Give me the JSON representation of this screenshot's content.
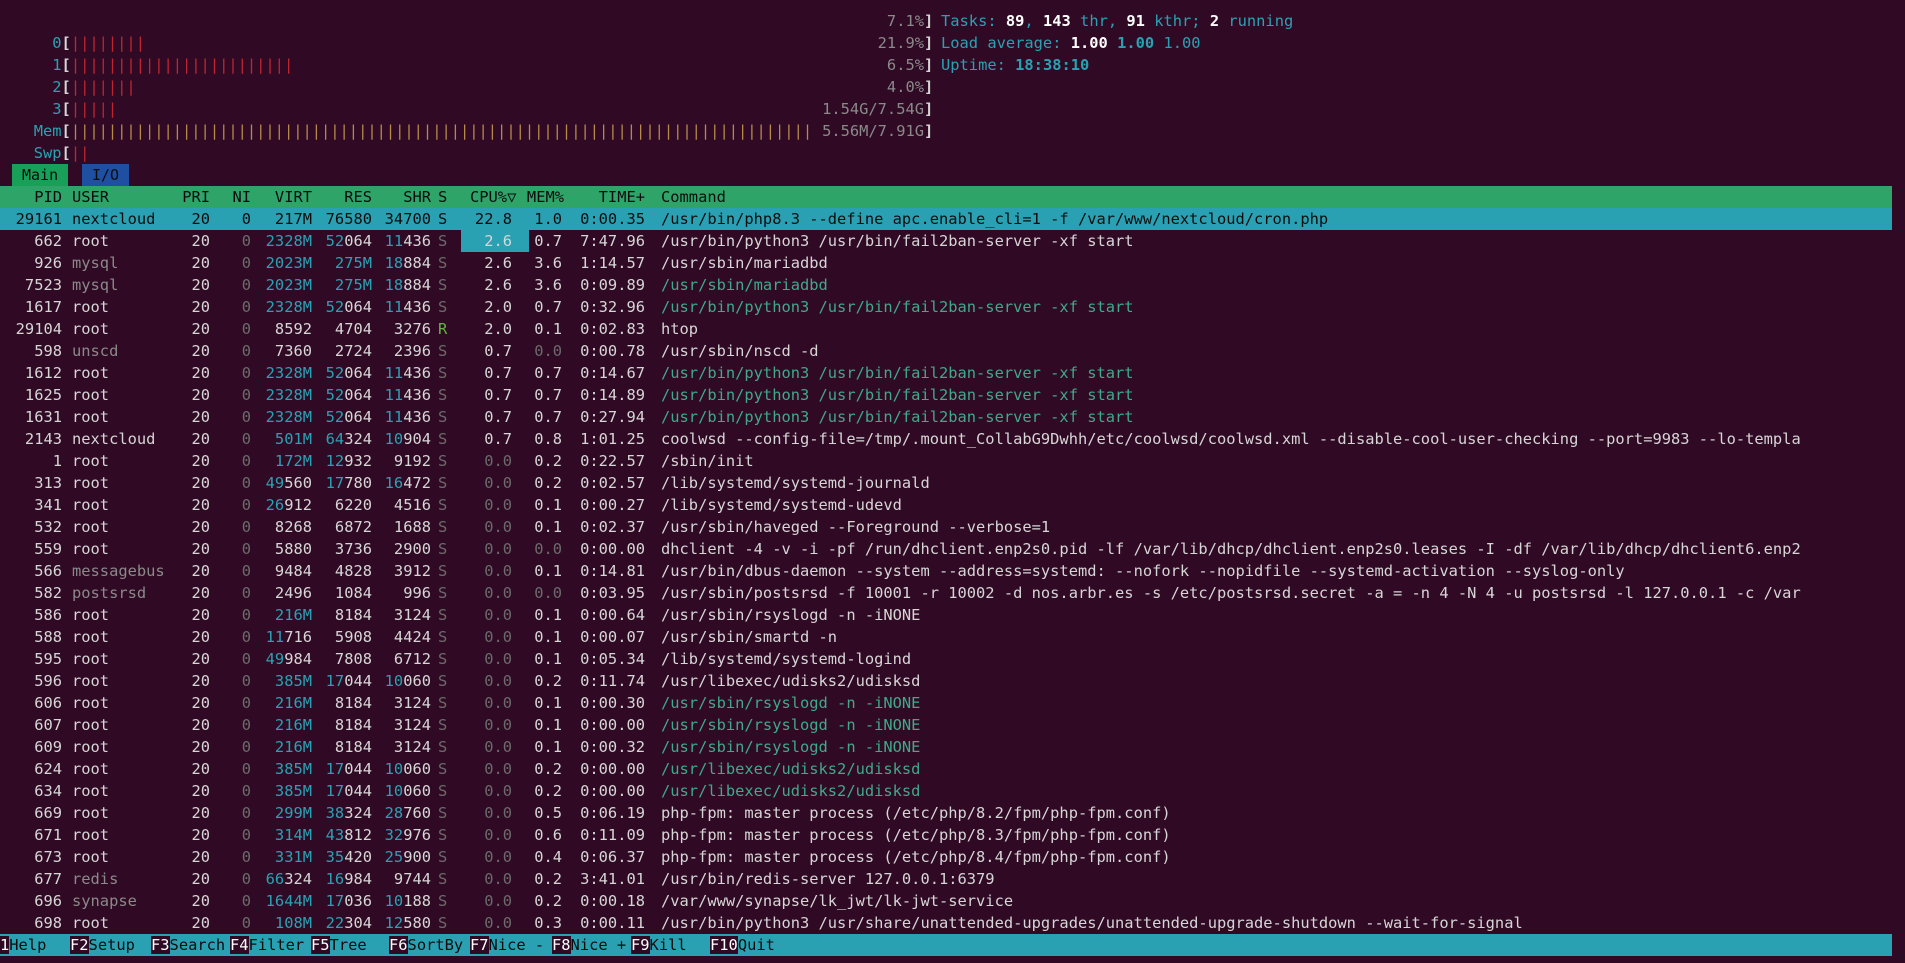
{
  "meters": {
    "cpu0": {
      "label": "0",
      "bars": "||||||||",
      "value": "7.1%"
    },
    "cpu1": {
      "label": "1",
      "bars": "||||||||||||||||||||||||",
      "value": "21.9%"
    },
    "cpu2": {
      "label": "2",
      "bars": "|||||||",
      "value": "6.5%"
    },
    "cpu3": {
      "label": "3",
      "bars": "|||||",
      "value": "4.0%"
    },
    "mem": {
      "label": "Mem",
      "bars": "||||||||||||||||||||||||||||||||||||||||||||||||||||||||||||||||||||||||||||||||",
      "value": "1.54G/7.54G"
    },
    "swp": {
      "label": "Swp",
      "bars": "||",
      "value": "5.56M/7.91G"
    }
  },
  "summary": {
    "tasks_label": "Tasks: ",
    "tasks": "89",
    "thr": "143",
    "kthr": "91",
    "running": "2",
    "thr_label": " thr, ",
    "kthr_label": " kthr; ",
    "running_label": " running",
    "load_label": "Load average: ",
    "load1": "1.00",
    "load5": "1.00",
    "load15": "1.00",
    "uptime_label": "Uptime: ",
    "uptime": "18:38:10"
  },
  "tabs": {
    "main": "Main",
    "io": "I/O"
  },
  "columns": {
    "pid": "PID",
    "user": "USER",
    "pri": "PRI",
    "ni": "NI",
    "virt": "VIRT",
    "res": "RES",
    "shr": "SHR",
    "s": "S",
    "cpu": "CPU%▽",
    "mem": "MEM%",
    "time": "TIME+",
    "cmd": "Command"
  },
  "processes": [
    {
      "pid": "29161",
      "user": "nextcloud",
      "pri": "20",
      "ni": "0",
      "virt": "217M",
      "res": "76580",
      "shr": "34700",
      "s": "S",
      "cpu": "22.8",
      "mem": "1.0",
      "time": "0:00.35",
      "cmd": "/usr/bin/php8.3 --define apc.enable_cli=1 -f /var/www/nextcloud/cron.php"
    },
    {
      "pid": "662",
      "user": "root",
      "pri": "20",
      "ni": "0",
      "virt": "2328M",
      "res": "52064",
      "shr": "11436",
      "s": "S",
      "cpu": "2.6",
      "mem": "0.7",
      "time": "7:47.96",
      "cmd": "/usr/bin/python3 /usr/bin/fail2ban-server -xf start"
    },
    {
      "pid": "926",
      "user": "mysql",
      "pri": "20",
      "ni": "0",
      "virt": "2023M",
      "res": "275M",
      "shr": "18884",
      "s": "S",
      "cpu": "2.6",
      "mem": "3.6",
      "time": "1:14.57",
      "cmd": "/usr/sbin/mariadbd"
    },
    {
      "pid": "7523",
      "user": "mysql",
      "pri": "20",
      "ni": "0",
      "virt": "2023M",
      "res": "275M",
      "shr": "18884",
      "s": "S",
      "cpu": "2.6",
      "mem": "3.6",
      "time": "0:09.89",
      "cmd": "/usr/sbin/mariadbd"
    },
    {
      "pid": "1617",
      "user": "root",
      "pri": "20",
      "ni": "0",
      "virt": "2328M",
      "res": "52064",
      "shr": "11436",
      "s": "S",
      "cpu": "2.0",
      "mem": "0.7",
      "time": "0:32.96",
      "cmd": "/usr/bin/python3 /usr/bin/fail2ban-server -xf start"
    },
    {
      "pid": "29104",
      "user": "root",
      "pri": "20",
      "ni": "0",
      "virt": "8592",
      "res": "4704",
      "shr": "3276",
      "s": "R",
      "cpu": "2.0",
      "mem": "0.1",
      "time": "0:02.83",
      "cmd": "htop"
    },
    {
      "pid": "598",
      "user": "unscd",
      "pri": "20",
      "ni": "0",
      "virt": "7360",
      "res": "2724",
      "shr": "2396",
      "s": "S",
      "cpu": "0.7",
      "mem": "0.0",
      "time": "0:00.78",
      "cmd": "/usr/sbin/nscd -d"
    },
    {
      "pid": "1612",
      "user": "root",
      "pri": "20",
      "ni": "0",
      "virt": "2328M",
      "res": "52064",
      "shr": "11436",
      "s": "S",
      "cpu": "0.7",
      "mem": "0.7",
      "time": "0:14.67",
      "cmd": "/usr/bin/python3 /usr/bin/fail2ban-server -xf start"
    },
    {
      "pid": "1625",
      "user": "root",
      "pri": "20",
      "ni": "0",
      "virt": "2328M",
      "res": "52064",
      "shr": "11436",
      "s": "S",
      "cpu": "0.7",
      "mem": "0.7",
      "time": "0:14.89",
      "cmd": "/usr/bin/python3 /usr/bin/fail2ban-server -xf start"
    },
    {
      "pid": "1631",
      "user": "root",
      "pri": "20",
      "ni": "0",
      "virt": "2328M",
      "res": "52064",
      "shr": "11436",
      "s": "S",
      "cpu": "0.7",
      "mem": "0.7",
      "time": "0:27.94",
      "cmd": "/usr/bin/python3 /usr/bin/fail2ban-server -xf start"
    },
    {
      "pid": "2143",
      "user": "nextcloud",
      "pri": "20",
      "ni": "0",
      "virt": "501M",
      "res": "64324",
      "shr": "10904",
      "s": "S",
      "cpu": "0.7",
      "mem": "0.8",
      "time": "1:01.25",
      "cmd": "coolwsd --config-file=/tmp/.mount_CollabG9Dwhh/etc/coolwsd/coolwsd.xml --disable-cool-user-checking --port=9983 --lo-templa"
    },
    {
      "pid": "1",
      "user": "root",
      "pri": "20",
      "ni": "0",
      "virt": "172M",
      "res": "12932",
      "shr": "9192",
      "s": "S",
      "cpu": "0.0",
      "mem": "0.2",
      "time": "0:22.57",
      "cmd": "/sbin/init"
    },
    {
      "pid": "313",
      "user": "root",
      "pri": "20",
      "ni": "0",
      "virt": "49560",
      "res": "17780",
      "shr": "16472",
      "s": "S",
      "cpu": "0.0",
      "mem": "0.2",
      "time": "0:02.57",
      "cmd": "/lib/systemd/systemd-journald"
    },
    {
      "pid": "341",
      "user": "root",
      "pri": "20",
      "ni": "0",
      "virt": "26912",
      "res": "6220",
      "shr": "4516",
      "s": "S",
      "cpu": "0.0",
      "mem": "0.1",
      "time": "0:00.27",
      "cmd": "/lib/systemd/systemd-udevd"
    },
    {
      "pid": "532",
      "user": "root",
      "pri": "20",
      "ni": "0",
      "virt": "8268",
      "res": "6872",
      "shr": "1688",
      "s": "S",
      "cpu": "0.0",
      "mem": "0.1",
      "time": "0:02.37",
      "cmd": "/usr/sbin/haveged --Foreground --verbose=1"
    },
    {
      "pid": "559",
      "user": "root",
      "pri": "20",
      "ni": "0",
      "virt": "5880",
      "res": "3736",
      "shr": "2900",
      "s": "S",
      "cpu": "0.0",
      "mem": "0.0",
      "time": "0:00.00",
      "cmd": "dhclient -4 -v -i -pf /run/dhclient.enp2s0.pid -lf /var/lib/dhcp/dhclient.enp2s0.leases -I -df /var/lib/dhcp/dhclient6.enp2"
    },
    {
      "pid": "566",
      "user": "messagebus",
      "pri": "20",
      "ni": "0",
      "virt": "9484",
      "res": "4828",
      "shr": "3912",
      "s": "S",
      "cpu": "0.0",
      "mem": "0.1",
      "time": "0:14.81",
      "cmd": "/usr/bin/dbus-daemon --system --address=systemd: --nofork --nopidfile --systemd-activation --syslog-only"
    },
    {
      "pid": "582",
      "user": "postsrsd",
      "pri": "20",
      "ni": "0",
      "virt": "2496",
      "res": "1084",
      "shr": "996",
      "s": "S",
      "cpu": "0.0",
      "mem": "0.0",
      "time": "0:03.95",
      "cmd": "/usr/sbin/postsrsd -f 10001 -r 10002 -d nos.arbr.es -s /etc/postsrsd.secret -a = -n 4 -N 4 -u postsrsd -l 127.0.0.1 -c /var"
    },
    {
      "pid": "586",
      "user": "root",
      "pri": "20",
      "ni": "0",
      "virt": "216M",
      "res": "8184",
      "shr": "3124",
      "s": "S",
      "cpu": "0.0",
      "mem": "0.1",
      "time": "0:00.64",
      "cmd": "/usr/sbin/rsyslogd -n -iNONE"
    },
    {
      "pid": "588",
      "user": "root",
      "pri": "20",
      "ni": "0",
      "virt": "11716",
      "res": "5908",
      "shr": "4424",
      "s": "S",
      "cpu": "0.0",
      "mem": "0.1",
      "time": "0:00.07",
      "cmd": "/usr/sbin/smartd -n"
    },
    {
      "pid": "595",
      "user": "root",
      "pri": "20",
      "ni": "0",
      "virt": "49984",
      "res": "7808",
      "shr": "6712",
      "s": "S",
      "cpu": "0.0",
      "mem": "0.1",
      "time": "0:05.34",
      "cmd": "/lib/systemd/systemd-logind"
    },
    {
      "pid": "596",
      "user": "root",
      "pri": "20",
      "ni": "0",
      "virt": "385M",
      "res": "17044",
      "shr": "10060",
      "s": "S",
      "cpu": "0.0",
      "mem": "0.2",
      "time": "0:11.74",
      "cmd": "/usr/libexec/udisks2/udisksd"
    },
    {
      "pid": "606",
      "user": "root",
      "pri": "20",
      "ni": "0",
      "virt": "216M",
      "res": "8184",
      "shr": "3124",
      "s": "S",
      "cpu": "0.0",
      "mem": "0.1",
      "time": "0:00.30",
      "cmd": "/usr/sbin/rsyslogd -n -iNONE"
    },
    {
      "pid": "607",
      "user": "root",
      "pri": "20",
      "ni": "0",
      "virt": "216M",
      "res": "8184",
      "shr": "3124",
      "s": "S",
      "cpu": "0.0",
      "mem": "0.1",
      "time": "0:00.00",
      "cmd": "/usr/sbin/rsyslogd -n -iNONE"
    },
    {
      "pid": "609",
      "user": "root",
      "pri": "20",
      "ni": "0",
      "virt": "216M",
      "res": "8184",
      "shr": "3124",
      "s": "S",
      "cpu": "0.0",
      "mem": "0.1",
      "time": "0:00.32",
      "cmd": "/usr/sbin/rsyslogd -n -iNONE"
    },
    {
      "pid": "624",
      "user": "root",
      "pri": "20",
      "ni": "0",
      "virt": "385M",
      "res": "17044",
      "shr": "10060",
      "s": "S",
      "cpu": "0.0",
      "mem": "0.2",
      "time": "0:00.00",
      "cmd": "/usr/libexec/udisks2/udisksd"
    },
    {
      "pid": "634",
      "user": "root",
      "pri": "20",
      "ni": "0",
      "virt": "385M",
      "res": "17044",
      "shr": "10060",
      "s": "S",
      "cpu": "0.0",
      "mem": "0.2",
      "time": "0:00.00",
      "cmd": "/usr/libexec/udisks2/udisksd"
    },
    {
      "pid": "669",
      "user": "root",
      "pri": "20",
      "ni": "0",
      "virt": "299M",
      "res": "38324",
      "shr": "28760",
      "s": "S",
      "cpu": "0.0",
      "mem": "0.5",
      "time": "0:06.19",
      "cmd": "php-fpm: master process (/etc/php/8.2/fpm/php-fpm.conf)"
    },
    {
      "pid": "671",
      "user": "root",
      "pri": "20",
      "ni": "0",
      "virt": "314M",
      "res": "43812",
      "shr": "32976",
      "s": "S",
      "cpu": "0.0",
      "mem": "0.6",
      "time": "0:11.09",
      "cmd": "php-fpm: master process (/etc/php/8.3/fpm/php-fpm.conf)"
    },
    {
      "pid": "673",
      "user": "root",
      "pri": "20",
      "ni": "0",
      "virt": "331M",
      "res": "35420",
      "shr": "25900",
      "s": "S",
      "cpu": "0.0",
      "mem": "0.4",
      "time": "0:06.37",
      "cmd": "php-fpm: master process (/etc/php/8.4/fpm/php-fpm.conf)"
    },
    {
      "pid": "677",
      "user": "redis",
      "pri": "20",
      "ni": "0",
      "virt": "66324",
      "res": "16984",
      "shr": "9744",
      "s": "S",
      "cpu": "0.0",
      "mem": "0.2",
      "time": "3:41.01",
      "cmd": "/usr/bin/redis-server 127.0.0.1:6379"
    },
    {
      "pid": "696",
      "user": "synapse",
      "pri": "20",
      "ni": "0",
      "virt": "1644M",
      "res": "17036",
      "shr": "10188",
      "s": "S",
      "cpu": "0.0",
      "mem": "0.2",
      "time": "0:00.18",
      "cmd": "/var/www/synapse/lk_jwt/lk-jwt-service"
    },
    {
      "pid": "698",
      "user": "root",
      "pri": "20",
      "ni": "0",
      "virt": "108M",
      "res": "22304",
      "shr": "12580",
      "s": "S",
      "cpu": "0.0",
      "mem": "0.3",
      "time": "0:00.11",
      "cmd": "/usr/bin/python3 /usr/share/unattended-upgrades/unattended-upgrade-shutdown --wait-for-signal"
    }
  ],
  "function_keys": [
    {
      "key": "1",
      "label": "Help"
    },
    {
      "key": "F2",
      "label": "Setup"
    },
    {
      "key": "F3",
      "label": "Search"
    },
    {
      "key": "F4",
      "label": "Filter"
    },
    {
      "key": "F5",
      "label": "Tree"
    },
    {
      "key": "F6",
      "label": "SortBy"
    },
    {
      "key": "F7",
      "label": "Nice -"
    },
    {
      "key": "F8",
      "label": "Nice +"
    },
    {
      "key": "F9",
      "label": "Kill"
    },
    {
      "key": "F10",
      "label": "Quit"
    }
  ]
}
